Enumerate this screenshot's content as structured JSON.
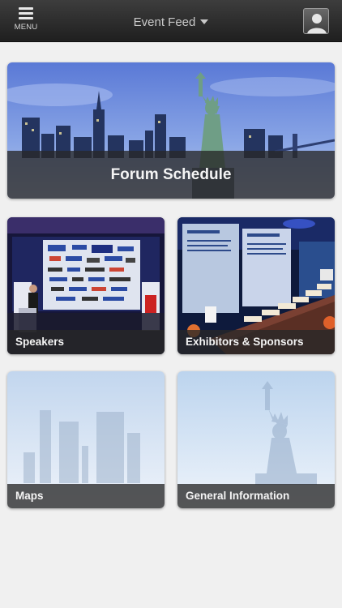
{
  "header": {
    "menu_label": "MENU",
    "title": "Event Feed"
  },
  "tiles": [
    {
      "label": "Forum Schedule"
    },
    {
      "label": "Speakers"
    },
    {
      "label": "Exhibitors & Sponsors"
    },
    {
      "label": "Maps"
    },
    {
      "label": "General Information"
    }
  ],
  "colors": {
    "header_bg": "#2b2b2b",
    "label_bg": "#333333",
    "page_bg": "#f0f0f0",
    "sky_blue": "#6f8fd9"
  },
  "icons": [
    "menu-icon",
    "caret-down-icon",
    "profile-icon"
  ]
}
